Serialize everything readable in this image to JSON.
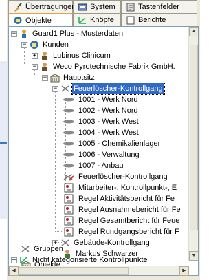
{
  "tabs_row1": [
    {
      "label": "Übertragungen",
      "icon": "broom-icon"
    },
    {
      "label": "System",
      "icon": "system-icon"
    },
    {
      "label": "Tastenfelder",
      "icon": "keypad-icon"
    }
  ],
  "tabs_row2": [
    {
      "label": "Objekte",
      "icon": "objects-icon",
      "active": true
    },
    {
      "label": "Knöpfe",
      "icon": "buttons-icon"
    },
    {
      "label": "Berichte",
      "icon": "reports-icon"
    }
  ],
  "tree": {
    "root": "Guard1 Plus - Musterdaten",
    "kunden": "Kunden",
    "lubinus": "Lubinus Clinicum",
    "weco": "Weco Pyrotechnische Fabrik GmbH.",
    "hauptsitz": "Hauptsitz",
    "rundgang": "Feuerlöscher-Kontrollgang",
    "checkpoints": [
      "1001 - Werk Nord",
      "1002 - Werk Nord",
      "1003 - Werk West",
      "1004 - Werk West",
      "1005 - Chemikalienlager",
      "1006 - Verwaltung",
      "1007 - Anbau"
    ],
    "rundgang_item": "Feuerlöscher-Kontrollgang",
    "reports": [
      "Mitarbeiter-, Kontrollpunkt-, E",
      "Regel Aktivitätsbericht für Fe",
      "Regel Ausnahmebericht für Fe",
      "Regel Gesamtbericht für Feue",
      "Regel Rundgangsbericht für F"
    ],
    "gebaeude": "Gebäude-Kontrollgang",
    "person": "Markus Schwarzer",
    "objekte": "Objekte",
    "gruppen": "Gruppen",
    "nicht_kat": "Nicht kategorisierte Kontrollpunkte"
  }
}
